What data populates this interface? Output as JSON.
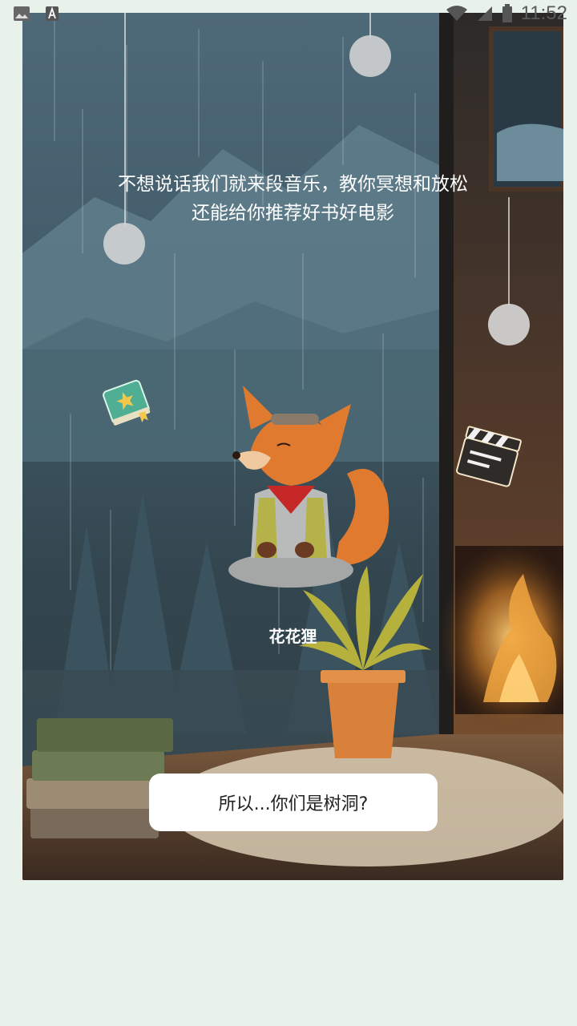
{
  "status_bar": {
    "time": "11:52",
    "icons": [
      "image-icon",
      "text-a-icon",
      "wifi-icon",
      "signal-icon",
      "battery-icon"
    ]
  },
  "scene": {
    "intro_line1": "不想说话我们就来段音乐，教你冥想和放松",
    "intro_line2": "还能给你推荐好书好电影",
    "character_name": "花花狸",
    "floating_icons": [
      "book-icon",
      "clapperboard-icon"
    ]
  },
  "reply": {
    "label": "所以...你们是树洞?"
  },
  "colors": {
    "page_background": "#e8f1ea",
    "accent_orange": "#e07a2e",
    "bandana_red": "#c62828",
    "book_green": "#4fae93"
  }
}
